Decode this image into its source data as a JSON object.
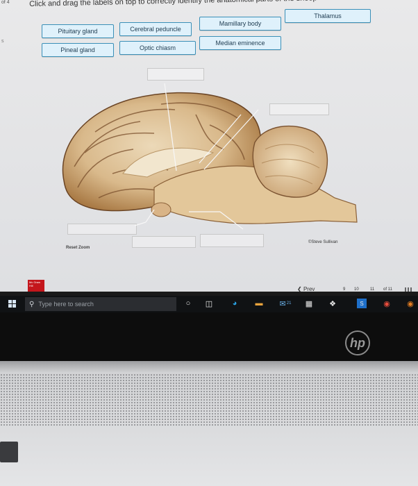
{
  "screen": {
    "corner_text": "of 4",
    "corner_text2": "s",
    "instruction": "Click and drag the labels on top to correctly identify the anatomical parts of the sheep",
    "labels": [
      "Pituitary gland",
      "Cerebral peduncle",
      "Mamillary body",
      "Thalamus",
      "Pineal gland",
      "Optic chiasm",
      "Median eminence"
    ],
    "image_credit": "©Steve Sullivan",
    "reset_zoom": "Reset Zoom",
    "publisher_logo_text": "Mc Graw Hill",
    "prev_label": "Prev",
    "pages": [
      "9",
      "10",
      "11"
    ],
    "of_total": "of 11"
  },
  "taskbar": {
    "search_placeholder": "Type here to search",
    "badge": "21"
  },
  "laptop": {
    "brand": "hp"
  },
  "colors": {
    "label_border": "#3a8fb7",
    "label_fill": "#dff1fb",
    "taskbar": "#101214"
  }
}
